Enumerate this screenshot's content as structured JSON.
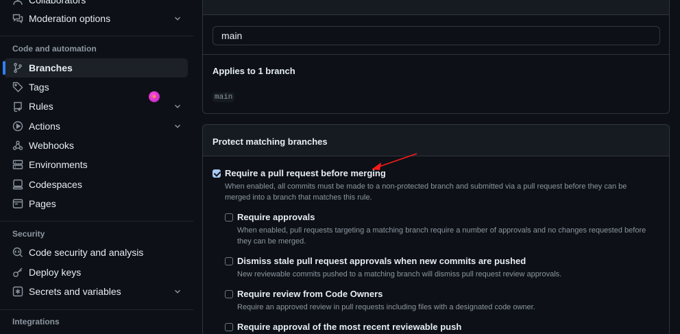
{
  "sidebar": {
    "top_items": [
      {
        "label": "Collaborators",
        "icon": "person-icon"
      },
      {
        "label": "Moderation options",
        "icon": "comment-discussion-icon"
      }
    ],
    "sections": {
      "code_automation": "Code and automation",
      "security": "Security",
      "integrations": "Integrations"
    },
    "code_items": [
      {
        "label": "Branches",
        "icon": "git-branch-icon",
        "active": true
      },
      {
        "label": "Tags",
        "icon": "tag-icon"
      },
      {
        "label": "Rules",
        "icon": "repo-push-icon"
      },
      {
        "label": "Actions",
        "icon": "play-icon"
      },
      {
        "label": "Webhooks",
        "icon": "webhook-icon"
      },
      {
        "label": "Environments",
        "icon": "server-icon"
      },
      {
        "label": "Codespaces",
        "icon": "codespaces-icon"
      },
      {
        "label": "Pages",
        "icon": "browser-icon"
      }
    ],
    "security_items": [
      {
        "label": "Code security and analysis",
        "icon": "codescan-icon"
      },
      {
        "label": "Deploy keys",
        "icon": "key-icon"
      },
      {
        "label": "Secrets and variables",
        "icon": "asterisk-icon"
      }
    ]
  },
  "branch_pattern": {
    "value": "main",
    "applies_title": "Applies to 1 branch",
    "matched_branch": "main"
  },
  "protect": {
    "title": "Protect matching branches",
    "rules": [
      {
        "label": "Require a pull request before merging",
        "checked": true,
        "desc_line1": "When enabled, all commits must be made to a non-protected branch and submitted via a pull request before they can be",
        "desc_line2": "merged into a branch that matches this rule."
      },
      {
        "label": "Require approvals",
        "checked": false,
        "desc_line1": "When enabled, pull requests targeting a matching branch require a number of approvals and no changes requested before",
        "desc_line2": "they can be merged."
      },
      {
        "label": "Dismiss stale pull request approvals when new commits are pushed",
        "checked": false,
        "desc_line1": "New reviewable commits pushed to a matching branch will dismiss pull request review approvals."
      },
      {
        "label": "Require review from Code Owners",
        "checked": false,
        "desc_line1": "Require an approved review in pull requests including files with a designated code owner."
      },
      {
        "label": "Require approval of the most recent reviewable push",
        "checked": false
      }
    ]
  },
  "colors": {
    "background": "#0d1117",
    "accent": "#2f81f7",
    "annotation_arrow": "#ff1a1a"
  }
}
